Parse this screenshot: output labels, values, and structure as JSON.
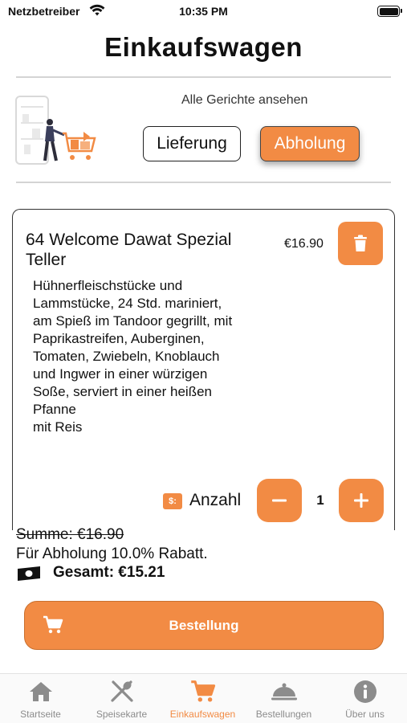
{
  "status_bar": {
    "carrier": "Netzbetreiber",
    "time": "10:35 PM"
  },
  "page_title": "Einkaufswagen",
  "see_all_label": "Alle Gerichte ansehen",
  "mode": {
    "delivery_label": "Lieferung",
    "pickup_label": "Abholung",
    "selected": "Abholung"
  },
  "cart_item": {
    "name": "64 Welcome Dawat Spezial Teller",
    "price": "€16.90",
    "description": "Hühnerfleischstücke und\nLammstücke, 24 Std. mariniert,\nam Spieß im Tandoor gegrillt, mit\nPaprikastreifen, Auberginen,\nTomaten, Zwiebeln, Knoblauch\nund Ingwer in einer würzigen\nSoße, serviert in einer heißen\nPfanne\nmit Reis",
    "quantity_label": "Anzahl",
    "quantity": "1",
    "quantity_icon_text": "$:"
  },
  "summary": {
    "sum": "Summe: €16.90",
    "discount": "Für Abholung 10.0% Rabatt.",
    "total": "Gesamt: €15.21"
  },
  "order_button_label": "Bestellung",
  "tabs": [
    {
      "label": "Startseite",
      "icon": "home-icon"
    },
    {
      "label": "Speisekarte",
      "icon": "fork-spoon-icon"
    },
    {
      "label": "Einkaufswagen",
      "icon": "cart-icon",
      "active": true
    },
    {
      "label": "Bestellungen",
      "icon": "cloche-icon"
    },
    {
      "label": "Über uns",
      "icon": "info-icon"
    }
  ],
  "colors": {
    "accent": "#f28b44",
    "tab_inactive": "#8c8c8c"
  }
}
